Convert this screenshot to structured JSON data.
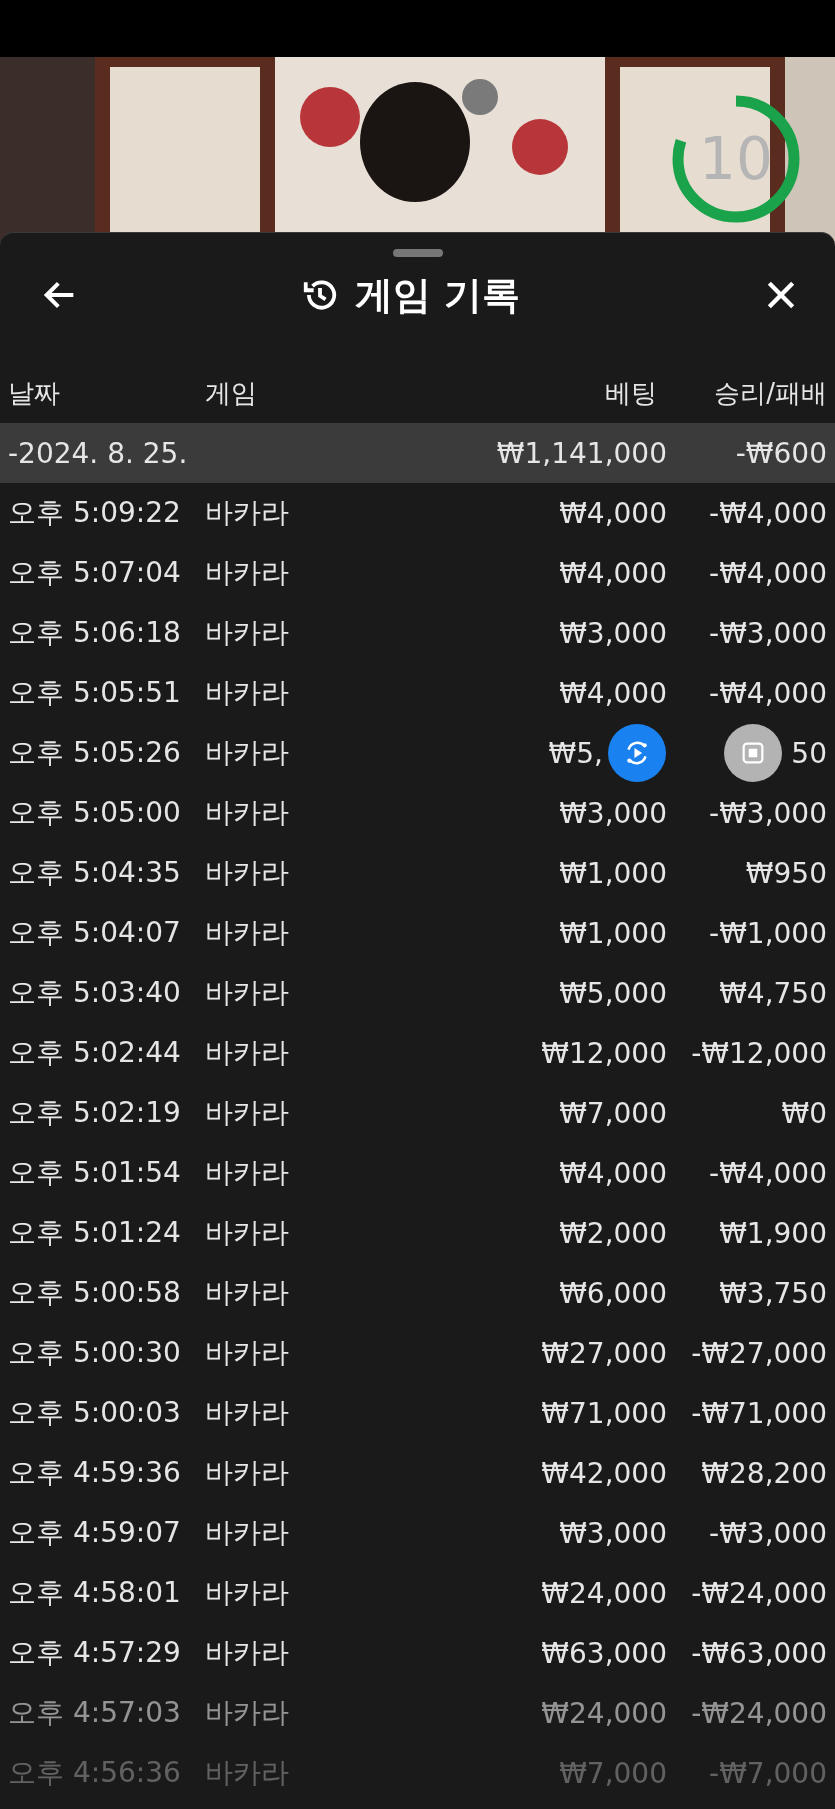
{
  "timer": {
    "text": "10"
  },
  "header": {
    "title": "게임 기록"
  },
  "columns": [
    "날짜",
    "게임",
    "베팅",
    "승리/패배"
  ],
  "date_group": {
    "date": "-2024. 8. 25.",
    "bet": "₩1,141,000",
    "result": "-₩600"
  },
  "rows": [
    {
      "time": "오후 5:09:22",
      "game": "바카라",
      "bet": "₩4,000",
      "result": "-₩4,000"
    },
    {
      "time": "오후 5:07:04",
      "game": "바카라",
      "bet": "₩4,000",
      "result": "-₩4,000"
    },
    {
      "time": "오후 5:06:18",
      "game": "바카라",
      "bet": "₩3,000",
      "result": "-₩3,000"
    },
    {
      "time": "오후 5:05:51",
      "game": "바카라",
      "bet": "₩4,000",
      "result": "-₩4,000"
    },
    {
      "time": "오후 5:05:26",
      "game": "바카라",
      "bet": "₩5,",
      "result": "50",
      "covered": true
    },
    {
      "time": "오후 5:05:00",
      "game": "바카라",
      "bet": "₩3,000",
      "result": "-₩3,000"
    },
    {
      "time": "오후 5:04:35",
      "game": "바카라",
      "bet": "₩1,000",
      "result": "₩950"
    },
    {
      "time": "오후 5:04:07",
      "game": "바카라",
      "bet": "₩1,000",
      "result": "-₩1,000"
    },
    {
      "time": "오후 5:03:40",
      "game": "바카라",
      "bet": "₩5,000",
      "result": "₩4,750"
    },
    {
      "time": "오후 5:02:44",
      "game": "바카라",
      "bet": "₩12,000",
      "result": "-₩12,000"
    },
    {
      "time": "오후 5:02:19",
      "game": "바카라",
      "bet": "₩7,000",
      "result": "₩0"
    },
    {
      "time": "오후 5:01:54",
      "game": "바카라",
      "bet": "₩4,000",
      "result": "-₩4,000"
    },
    {
      "time": "오후 5:01:24",
      "game": "바카라",
      "bet": "₩2,000",
      "result": "₩1,900"
    },
    {
      "time": "오후 5:00:58",
      "game": "바카라",
      "bet": "₩6,000",
      "result": "₩3,750"
    },
    {
      "time": "오후 5:00:30",
      "game": "바카라",
      "bet": "₩27,000",
      "result": "-₩27,000"
    },
    {
      "time": "오후 5:00:03",
      "game": "바카라",
      "bet": "₩71,000",
      "result": "-₩71,000"
    },
    {
      "time": "오후 4:59:36",
      "game": "바카라",
      "bet": "₩42,000",
      "result": "₩28,200"
    },
    {
      "time": "오후 4:59:07",
      "game": "바카라",
      "bet": "₩3,000",
      "result": "-₩3,000"
    },
    {
      "time": "오후 4:58:01",
      "game": "바카라",
      "bet": "₩24,000",
      "result": "-₩24,000"
    },
    {
      "time": "오후 4:57:29",
      "game": "바카라",
      "bet": "₩63,000",
      "result": "-₩63,000"
    },
    {
      "time": "오후 4:57:03",
      "game": "바카라",
      "bet": "₩24,000",
      "result": "-₩24,000"
    },
    {
      "time": "오후 4:56:36",
      "game": "바카라",
      "bet": "₩7,000",
      "result": "-₩7,000"
    }
  ]
}
